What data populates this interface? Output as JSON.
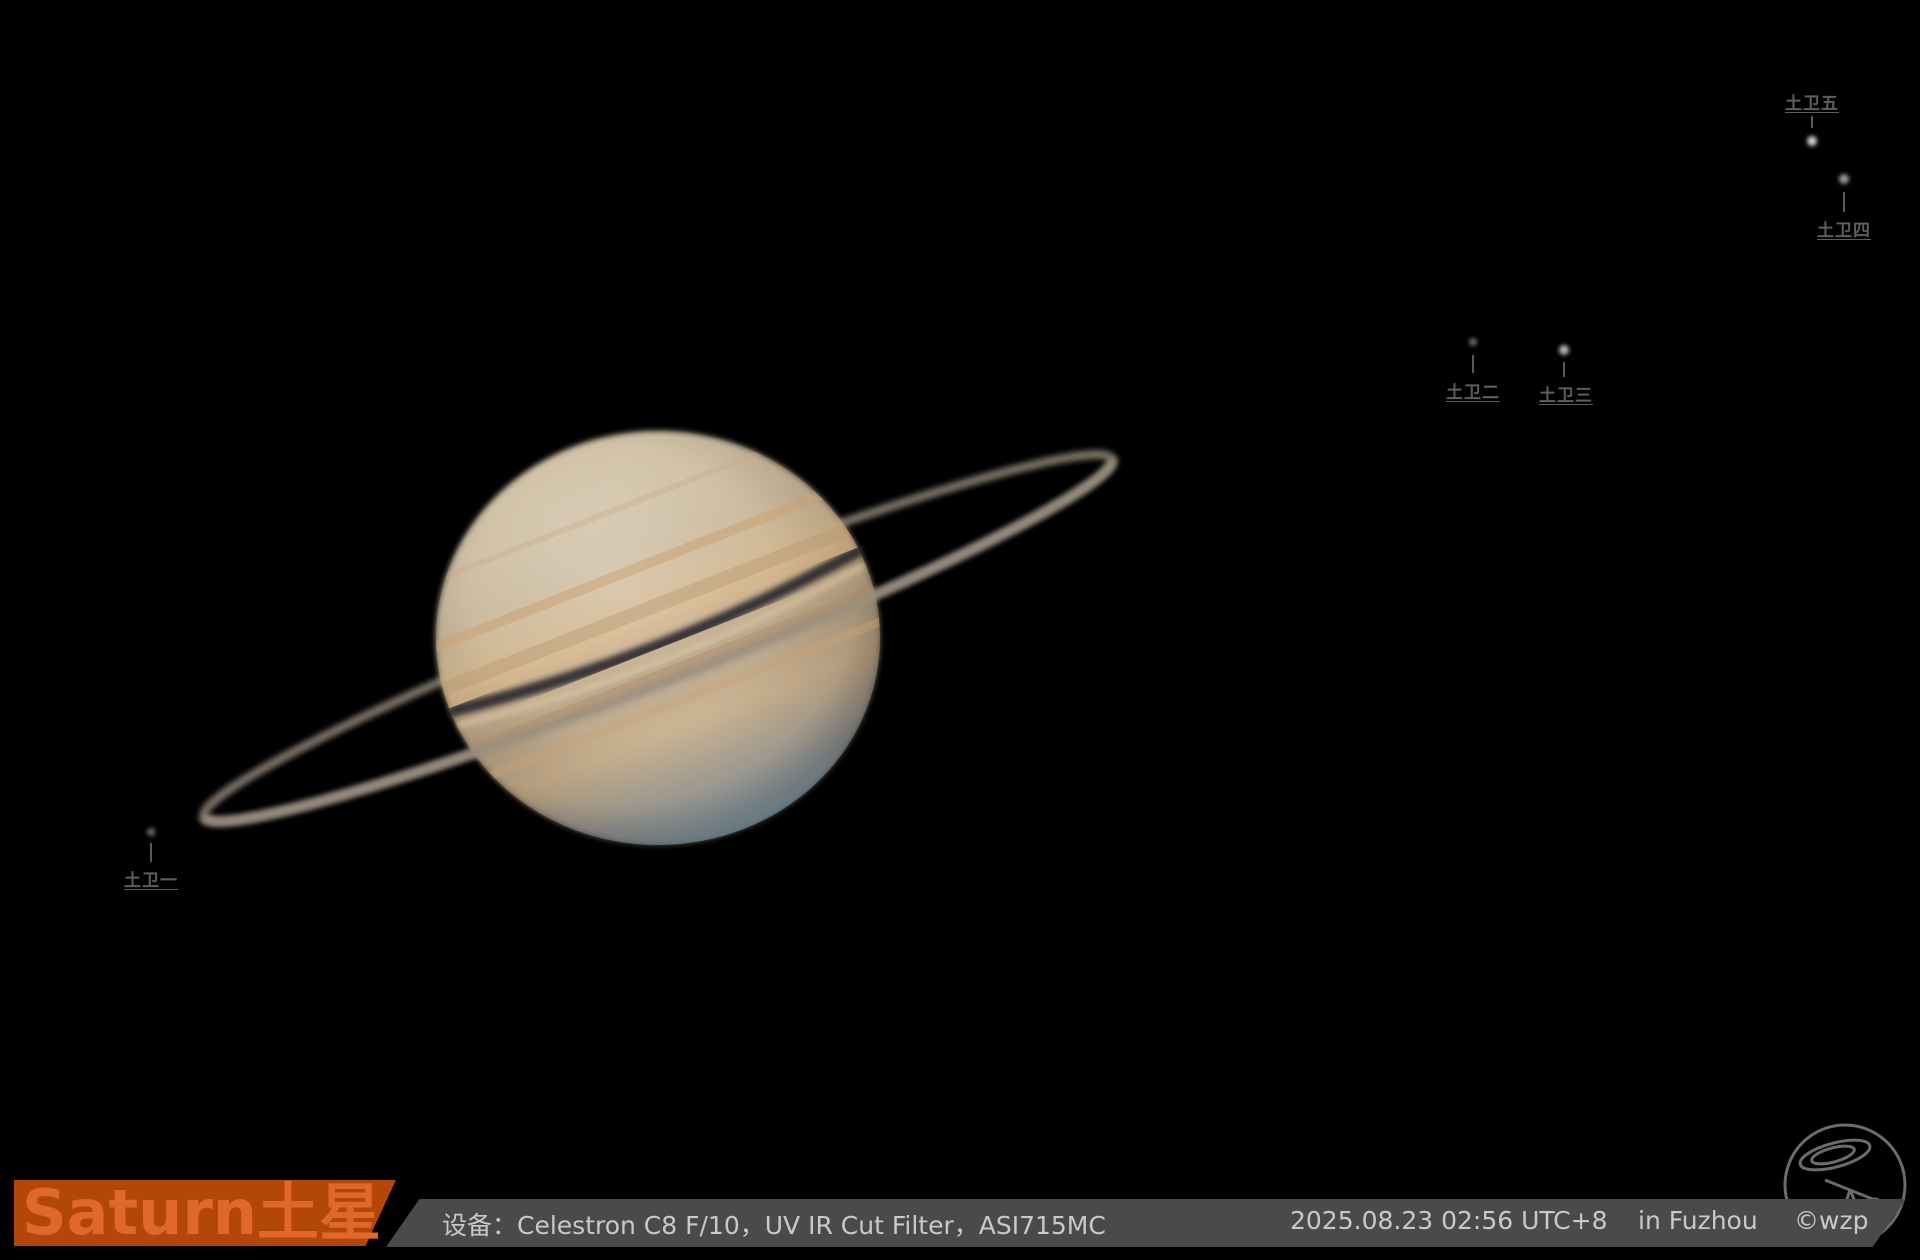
{
  "title": "Saturn土星",
  "equipment": "设备：Celestron C8 F/10，UV IR Cut Filter，ASI715MC",
  "datetime": "2025.08.23  02:56  UTC+8",
  "location": "in Fuzhou",
  "copyright": "©wzp",
  "moons": [
    {
      "label": "土卫一"
    },
    {
      "label": "土卫二"
    },
    {
      "label": "土卫三"
    },
    {
      "label": "土卫四"
    },
    {
      "label": "土卫五"
    }
  ],
  "colors": {
    "background": "#000000",
    "title_box": "#b24709",
    "title_text": "#e0682a",
    "info_bar": "#4a4a4a",
    "info_text": "#c9c9c9"
  }
}
